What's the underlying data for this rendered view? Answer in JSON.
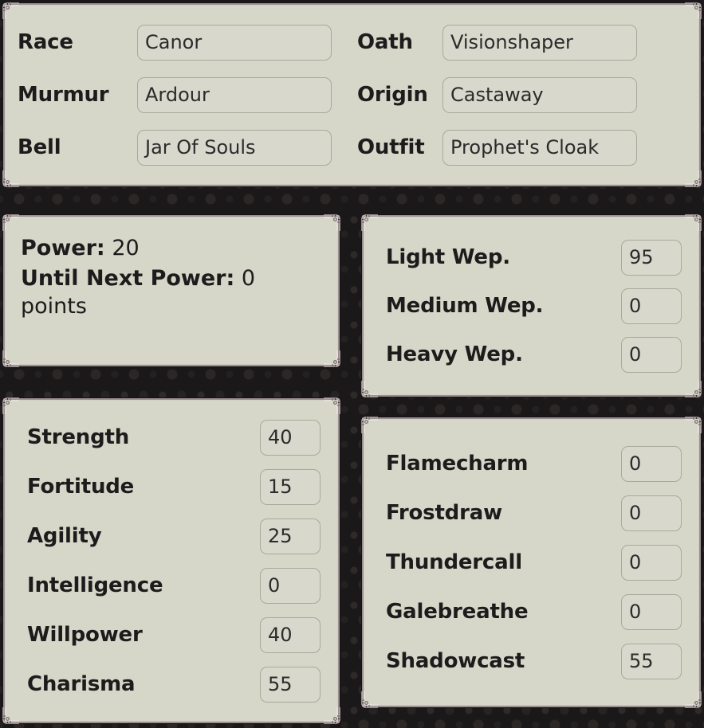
{
  "theme": {
    "panel_bg": "#d6d6c9",
    "panel_border": "#9c8f92",
    "field_bg": "#d8d8cc",
    "field_border": "#a9a99b",
    "text": "#1c1c1c",
    "backdrop": "#1a1818"
  },
  "identity": {
    "fields": [
      {
        "label": "Race",
        "value": "Canor"
      },
      {
        "label": "Oath",
        "value": "Visionshaper"
      },
      {
        "label": "Murmur",
        "value": "Ardour"
      },
      {
        "label": "Origin",
        "value": "Castaway"
      },
      {
        "label": "Bell",
        "value": "Jar Of Souls"
      },
      {
        "label": "Outfit",
        "value": "Prophet's Cloak"
      }
    ]
  },
  "power": {
    "power_label": "Power:",
    "power_value": "20",
    "until_next_label": "Until Next Power:",
    "until_next_value": "0",
    "units": "points"
  },
  "weapons": {
    "rows": [
      {
        "name": "Light Wep.",
        "value": "95"
      },
      {
        "name": "Medium Wep.",
        "value": "0"
      },
      {
        "name": "Heavy Wep.",
        "value": "0"
      }
    ]
  },
  "stats": {
    "rows": [
      {
        "name": "Strength",
        "value": "40"
      },
      {
        "name": "Fortitude",
        "value": "15"
      },
      {
        "name": "Agility",
        "value": "25"
      },
      {
        "name": "Intelligence",
        "value": "0"
      },
      {
        "name": "Willpower",
        "value": "40"
      },
      {
        "name": "Charisma",
        "value": "55"
      }
    ]
  },
  "magic": {
    "rows": [
      {
        "name": "Flamecharm",
        "value": "0"
      },
      {
        "name": "Frostdraw",
        "value": "0"
      },
      {
        "name": "Thundercall",
        "value": "0"
      },
      {
        "name": "Galebreathe",
        "value": "0"
      },
      {
        "name": "Shadowcast",
        "value": "55"
      }
    ]
  }
}
